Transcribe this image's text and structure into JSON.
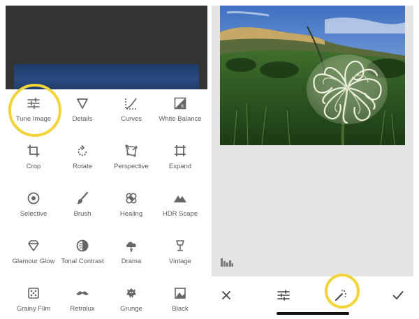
{
  "theme": {
    "accent_highlight": "#f2d33a",
    "icon_color": "#666666",
    "label_color": "#5a5a5a"
  },
  "tools": [
    {
      "label": "Tune Image",
      "icon": "sliders-icon"
    },
    {
      "label": "Details",
      "icon": "triangle-icon"
    },
    {
      "label": "Curves",
      "icon": "curves-icon"
    },
    {
      "label": "White Balance",
      "icon": "white-balance-icon"
    },
    {
      "label": "Crop",
      "icon": "crop-icon"
    },
    {
      "label": "Rotate",
      "icon": "rotate-icon"
    },
    {
      "label": "Perspective",
      "icon": "perspective-icon"
    },
    {
      "label": "Expand",
      "icon": "expand-icon"
    },
    {
      "label": "Selective",
      "icon": "selective-icon"
    },
    {
      "label": "Brush",
      "icon": "brush-icon"
    },
    {
      "label": "Healing",
      "icon": "bandage-icon"
    },
    {
      "label": "HDR Scape",
      "icon": "mountain-icon"
    },
    {
      "label": "Glamour Glow",
      "icon": "diamond-icon"
    },
    {
      "label": "Tonal Contrast",
      "icon": "tonal-contrast-icon"
    },
    {
      "label": "Drama",
      "icon": "cloud-icon"
    },
    {
      "label": "Vintage",
      "icon": "lamp-icon"
    },
    {
      "label": "Grainy Film",
      "icon": "dice-icon"
    },
    {
      "label": "Retrolux",
      "icon": "mustache-icon"
    },
    {
      "label": "Grunge",
      "icon": "grunge-icon"
    },
    {
      "label": "Black",
      "icon": "black-white-icon"
    }
  ],
  "bottom_bar": {
    "buttons": [
      {
        "name": "cancel",
        "icon": "close-icon"
      },
      {
        "name": "adjust",
        "icon": "sliders-icon"
      },
      {
        "name": "auto-enhance",
        "icon": "magic-wand-icon"
      },
      {
        "name": "apply",
        "icon": "checkmark-icon"
      }
    ]
  }
}
